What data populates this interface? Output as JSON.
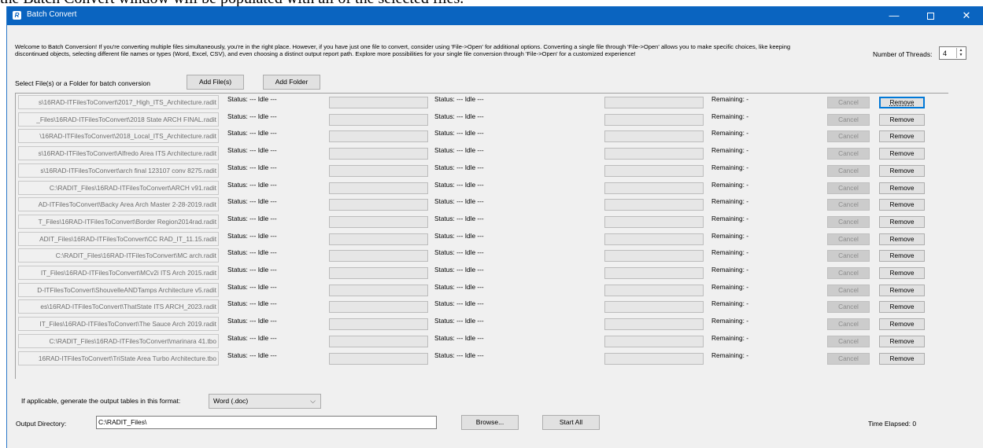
{
  "caption_text": "the Batch Convert window will be populated with all of the selected files.",
  "window": {
    "title": "Batch Convert",
    "icon": "R",
    "controls": [
      "minimize-icon",
      "maximize-icon",
      "close-icon"
    ],
    "close_glyph": "✕",
    "minimize_glyph": "—"
  },
  "intro_text": "Welcome to Batch Conversion! If you're converting multiple files simultaneously, you're in the right place. However, if you have just one file to convert, consider using 'File->Open' for additional options. Converting a single file through 'File->Open' allows you to make specific choices, like keeping discontinued objects, selecting different file names or types (Word, Excel, CSV), and even choosing a distinct output report path. Explore more possibilities for your single file conversion through 'File->Open' for a customized experience!",
  "threads": {
    "label": "Number of Threads:",
    "value": "4"
  },
  "select_label": "Select File(s) or a Folder for batch conversion",
  "add_files_label": "Add File(s)",
  "add_folder_label": "Add Folder",
  "row_labels": {
    "status": "Status: --- Idle ---",
    "remaining": "Remaining: -",
    "cancel": "Cancel",
    "remove": "Remove"
  },
  "files": [
    "s\\16RAD-ITFilesToConvert\\2017_High_ITS_Architecture.radit",
    "_Files\\16RAD-ITFilesToConvert\\2018 State ARCH FINAL.radit",
    "\\16RAD-ITFilesToConvert\\2018_Local_ITS_Architecture.radit",
    "s\\16RAD-ITFilesToConvert\\Alfredo Area ITS Architecture.radit",
    "s\\16RAD-ITFilesToConvert\\arch final 123107 conv 8275.radit",
    "C:\\RADIT_Files\\16RAD-ITFilesToConvert\\ARCH v91.radit",
    "AD-ITFilesToConvert\\Backy Area Arch Master 2-28-2019.radit",
    "T_Files\\16RAD-ITFilesToConvert\\Border Region2014rad.radit",
    "ADIT_Files\\16RAD-ITFilesToConvert\\CC RAD_IT_11.15.radit",
    "C:\\RADIT_Files\\16RAD-ITFilesToConvert\\MC arch.radit",
    "IT_Files\\16RAD-ITFilesToConvert\\MCv2i ITS Arch 2015.radit",
    "D-ITFilesToConvert\\ShouvelleANDTamps Architecture v5.radit",
    "es\\16RAD-ITFilesToConvert\\ThatState ITS ARCH_2023.radit",
    "IT_Files\\16RAD-ITFilesToConvert\\The Sauce Arch 2019.radit",
    "C:\\RADIT_Files\\16RAD-ITFilesToConvert\\marinara 41.tbo",
    "16RAD-ITFilesToConvert\\TriState Area Turbo Architecture.tbo"
  ],
  "format": {
    "label": "If applicable, generate the output tables in this format:",
    "selected": "Word (.doc)"
  },
  "output": {
    "label": "Output Directory:",
    "value": "C:\\RADIT_Files\\"
  },
  "browse_label": "Browse...",
  "start_label": "Start All",
  "elapsed_text": "Time Elapsed: 0"
}
